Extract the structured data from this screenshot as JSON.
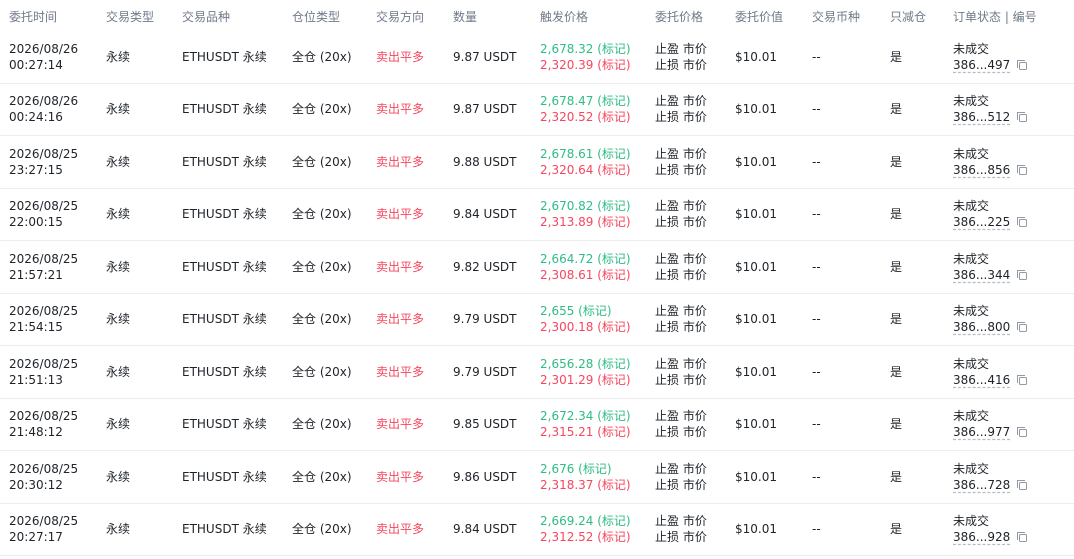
{
  "columns": {
    "time": "委托时间",
    "type": "交易类型",
    "symbol": "交易品种",
    "mode": "仓位类型",
    "direction": "交易方向",
    "quantity": "数量",
    "trigger": "触发价格",
    "price": "委托价格",
    "value": "委托价值",
    "coin": "交易币种",
    "reduce_only": "只减仓",
    "status_id": "订单状态 | 编号"
  },
  "rows": [
    {
      "date": "2026/08/26",
      "time": "00:27:14",
      "type": "永续",
      "symbol": "ETHUSDT 永续",
      "mode": "全仓 (20x)",
      "direction": "卖出平多",
      "quantity": "9.87 USDT",
      "tp_trigger": "2,678.32 (标记)",
      "sl_trigger": "2,320.39 (标记)",
      "tp_price": "止盈 市价",
      "sl_price": "止损 市价",
      "value": "$10.01",
      "coin": "--",
      "reduce_only": "是",
      "status": "未成交",
      "order_id": "386...497"
    },
    {
      "date": "2026/08/26",
      "time": "00:24:16",
      "type": "永续",
      "symbol": "ETHUSDT 永续",
      "mode": "全仓 (20x)",
      "direction": "卖出平多",
      "quantity": "9.87 USDT",
      "tp_trigger": "2,678.47 (标记)",
      "sl_trigger": "2,320.52 (标记)",
      "tp_price": "止盈 市价",
      "sl_price": "止损 市价",
      "value": "$10.01",
      "coin": "--",
      "reduce_only": "是",
      "status": "未成交",
      "order_id": "386...512"
    },
    {
      "date": "2026/08/25",
      "time": "23:27:15",
      "type": "永续",
      "symbol": "ETHUSDT 永续",
      "mode": "全仓 (20x)",
      "direction": "卖出平多",
      "quantity": "9.88 USDT",
      "tp_trigger": "2,678.61 (标记)",
      "sl_trigger": "2,320.64 (标记)",
      "tp_price": "止盈 市价",
      "sl_price": "止损 市价",
      "value": "$10.01",
      "coin": "--",
      "reduce_only": "是",
      "status": "未成交",
      "order_id": "386...856"
    },
    {
      "date": "2026/08/25",
      "time": "22:00:15",
      "type": "永续",
      "symbol": "ETHUSDT 永续",
      "mode": "全仓 (20x)",
      "direction": "卖出平多",
      "quantity": "9.84 USDT",
      "tp_trigger": "2,670.82 (标记)",
      "sl_trigger": "2,313.89 (标记)",
      "tp_price": "止盈 市价",
      "sl_price": "止损 市价",
      "value": "$10.01",
      "coin": "--",
      "reduce_only": "是",
      "status": "未成交",
      "order_id": "386...225"
    },
    {
      "date": "2026/08/25",
      "time": "21:57:21",
      "type": "永续",
      "symbol": "ETHUSDT 永续",
      "mode": "全仓 (20x)",
      "direction": "卖出平多",
      "quantity": "9.82 USDT",
      "tp_trigger": "2,664.72 (标记)",
      "sl_trigger": "2,308.61 (标记)",
      "tp_price": "止盈 市价",
      "sl_price": "止损 市价",
      "value": "$10.01",
      "coin": "--",
      "reduce_only": "是",
      "status": "未成交",
      "order_id": "386...344"
    },
    {
      "date": "2026/08/25",
      "time": "21:54:15",
      "type": "永续",
      "symbol": "ETHUSDT 永续",
      "mode": "全仓 (20x)",
      "direction": "卖出平多",
      "quantity": "9.79 USDT",
      "tp_trigger": "2,655 (标记)",
      "sl_trigger": "2,300.18 (标记)",
      "tp_price": "止盈 市价",
      "sl_price": "止损 市价",
      "value": "$10.01",
      "coin": "--",
      "reduce_only": "是",
      "status": "未成交",
      "order_id": "386...800"
    },
    {
      "date": "2026/08/25",
      "time": "21:51:13",
      "type": "永续",
      "symbol": "ETHUSDT 永续",
      "mode": "全仓 (20x)",
      "direction": "卖出平多",
      "quantity": "9.79 USDT",
      "tp_trigger": "2,656.28 (标记)",
      "sl_trigger": "2,301.29 (标记)",
      "tp_price": "止盈 市价",
      "sl_price": "止损 市价",
      "value": "$10.01",
      "coin": "--",
      "reduce_only": "是",
      "status": "未成交",
      "order_id": "386...416"
    },
    {
      "date": "2026/08/25",
      "time": "21:48:12",
      "type": "永续",
      "symbol": "ETHUSDT 永续",
      "mode": "全仓 (20x)",
      "direction": "卖出平多",
      "quantity": "9.85 USDT",
      "tp_trigger": "2,672.34 (标记)",
      "sl_trigger": "2,315.21 (标记)",
      "tp_price": "止盈 市价",
      "sl_price": "止损 市价",
      "value": "$10.01",
      "coin": "--",
      "reduce_only": "是",
      "status": "未成交",
      "order_id": "386...977"
    },
    {
      "date": "2026/08/25",
      "time": "20:30:12",
      "type": "永续",
      "symbol": "ETHUSDT 永续",
      "mode": "全仓 (20x)",
      "direction": "卖出平多",
      "quantity": "9.86 USDT",
      "tp_trigger": "2,676 (标记)",
      "sl_trigger": "2,318.37 (标记)",
      "tp_price": "止盈 市价",
      "sl_price": "止损 市价",
      "value": "$10.01",
      "coin": "--",
      "reduce_only": "是",
      "status": "未成交",
      "order_id": "386...728"
    },
    {
      "date": "2026/08/25",
      "time": "20:27:17",
      "type": "永续",
      "symbol": "ETHUSDT 永续",
      "mode": "全仓 (20x)",
      "direction": "卖出平多",
      "quantity": "9.84 USDT",
      "tp_trigger": "2,669.24 (标记)",
      "sl_trigger": "2,312.52 (标记)",
      "tp_price": "止盈 市价",
      "sl_price": "止损 市价",
      "value": "$10.01",
      "coin": "--",
      "reduce_only": "是",
      "status": "未成交",
      "order_id": "386...928"
    }
  ],
  "colors": {
    "tp_green": "#2ebd85",
    "sl_red": "#f6465d",
    "header_gray": "#707a8a",
    "divider": "#eaecef"
  },
  "icons": {
    "copy": "copy-icon"
  }
}
